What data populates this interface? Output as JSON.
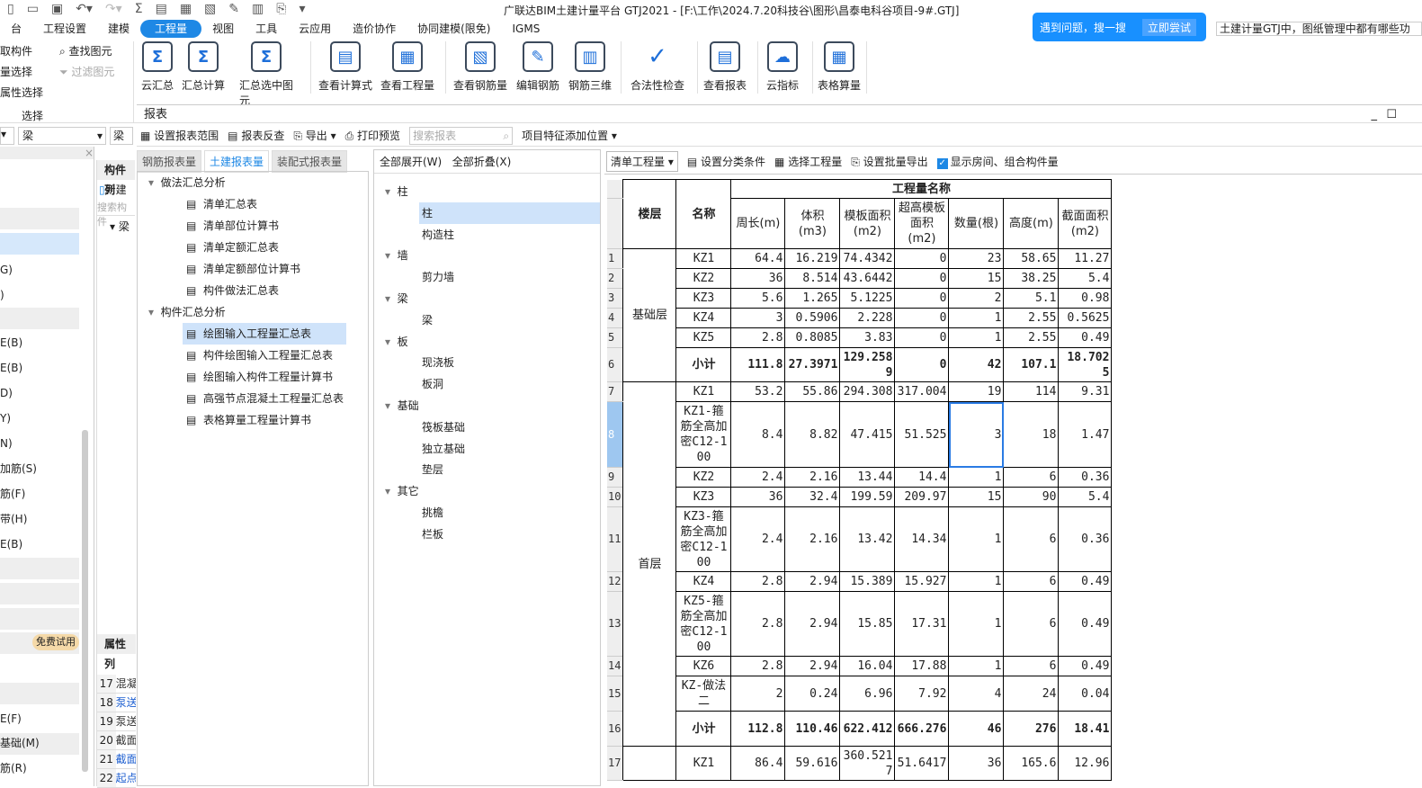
{
  "window": {
    "title": "广联达BIM土建计量平台 GTJ2021 - [F:\\工作\\2024.7.20科技谷\\图形\\昌泰电科谷项目-9#.GTJ]"
  },
  "menu": [
    "台",
    "工程设置",
    "建模",
    "工程量",
    "视图",
    "工具",
    "云应用",
    "造价协作",
    "协同建模(限免)",
    "IGMS"
  ],
  "menu_active": "工程量",
  "help": {
    "text": "遇到问题，搜一搜",
    "button": "立即尝试",
    "query": "土建计量GTJ中，图纸管理中都有哪些功"
  },
  "ribbon": {
    "select_group": {
      "items": [
        "取构件",
        "量选择",
        "属性选择",
        "查找图元",
        "过滤图元"
      ],
      "label": "选择"
    },
    "buttons": [
      "云汇总",
      "汇总计算",
      "汇总选中图元",
      "查看计算式",
      "查看工程量",
      "查看钢筋量",
      "编辑钢筋",
      "钢筋三维",
      "合法性检查",
      "查看报表",
      "云指标",
      "表格算量"
    ]
  },
  "left_panel": {
    "dropdowns": [
      "梁",
      "梁"
    ],
    "items": [
      "G)",
      ")",
      "E(B)",
      "E(B)",
      "D)",
      "Y)",
      "N)",
      "加筋(S)",
      "筋(F)",
      "带(H)",
      "E(B)",
      "E(F)",
      "基础(M)",
      "筋(R)"
    ],
    "trial_badge": "免费试用"
  },
  "component_panel": {
    "header": "构件列",
    "new": "新建",
    "search": "搜索构件",
    "tree": "梁",
    "props_header": "属性列",
    "prop_rows": [
      {
        "n": "17",
        "t": "混凝"
      },
      {
        "n": "18",
        "t": "泵送"
      },
      {
        "n": "19",
        "t": "泵送"
      },
      {
        "n": "20",
        "t": "截面"
      },
      {
        "n": "21",
        "t": "截面"
      },
      {
        "n": "22",
        "t": "起点"
      }
    ]
  },
  "report": {
    "title": "报表",
    "toolbar": {
      "range": "设置报表范围",
      "reverse": "报表反查",
      "export": "导出",
      "print": "打印预览",
      "search_placeholder": "搜索报表",
      "feature": "项目特征添加位置"
    },
    "tabs": [
      "钢筋报表量",
      "土建报表量",
      "装配式报表量"
    ],
    "active_tab": "土建报表量",
    "tree": [
      {
        "label": "做法汇总分析",
        "group": true
      },
      {
        "label": "清单汇总表"
      },
      {
        "label": "清单部位计算书"
      },
      {
        "label": "清单定额汇总表"
      },
      {
        "label": "清单定额部位计算书"
      },
      {
        "label": "构件做法汇总表"
      },
      {
        "label": "构件汇总分析",
        "group": true
      },
      {
        "label": "绘图输入工程量汇总表",
        "selected": true
      },
      {
        "label": "构件绘图输入工程量汇总表"
      },
      {
        "label": "绘图输入构件工程量计算书"
      },
      {
        "label": "高强节点混凝土工程量汇总表"
      },
      {
        "label": "表格算量工程量计算书"
      }
    ],
    "category_toolbar": {
      "expand": "全部展开(W)",
      "collapse": "全部折叠(X)"
    },
    "categories": [
      {
        "label": "柱",
        "group": true
      },
      {
        "label": "柱",
        "selected": true
      },
      {
        "label": "构造柱"
      },
      {
        "label": "墙",
        "group": true
      },
      {
        "label": "剪力墙"
      },
      {
        "label": "梁",
        "group": true
      },
      {
        "label": "梁"
      },
      {
        "label": "板",
        "group": true
      },
      {
        "label": "现浇板"
      },
      {
        "label": "板洞"
      },
      {
        "label": "基础",
        "group": true
      },
      {
        "label": "筏板基础"
      },
      {
        "label": "独立基础"
      },
      {
        "label": "垫层"
      },
      {
        "label": "其它",
        "group": true
      },
      {
        "label": "挑檐"
      },
      {
        "label": "栏板"
      }
    ],
    "grid_toolbar": {
      "type": "清单工程量",
      "classify": "设置分类条件",
      "select": "选择工程量",
      "batch_export": "设置批量导出",
      "show_rooms": "显示房间、组合构件量",
      "show_rooms_checked": true
    },
    "grid": {
      "group_header": "工程量名称",
      "floor_header": "楼层",
      "name_header": "名称",
      "columns": [
        "周长(m)",
        "体积(m3)",
        "模板面积(m2)",
        "超高模板面积(m2)",
        "数量(根)",
        "高度(m)",
        "截面面积(m2)"
      ],
      "rows": [
        {
          "n": "1",
          "floor": "基础层",
          "span": 6,
          "name": "KZ1",
          "v": [
            "64.4",
            "16.219",
            "74.4342",
            "0",
            "23",
            "58.65",
            "11.27"
          ]
        },
        {
          "n": "2",
          "name": "KZ2",
          "v": [
            "36",
            "8.514",
            "43.6442",
            "0",
            "15",
            "38.25",
            "5.4"
          ]
        },
        {
          "n": "3",
          "name": "KZ3",
          "v": [
            "5.6",
            "1.265",
            "5.1225",
            "0",
            "2",
            "5.1",
            "0.98"
          ]
        },
        {
          "n": "4",
          "name": "KZ4",
          "v": [
            "3",
            "0.5906",
            "2.228",
            "0",
            "1",
            "2.55",
            "0.5625"
          ]
        },
        {
          "n": "5",
          "name": "KZ5",
          "v": [
            "2.8",
            "0.8085",
            "3.83",
            "0",
            "1",
            "2.55",
            "0.49"
          ]
        },
        {
          "n": "6",
          "name": "小计",
          "subtotal": true,
          "v": [
            "111.8",
            "27.3971",
            "129.2589",
            "0",
            "42",
            "107.1",
            "18.7025"
          ]
        },
        {
          "n": "7",
          "floor": "首层",
          "span": 10,
          "name": "KZ1",
          "v": [
            "53.2",
            "55.86",
            "294.308",
            "317.004",
            "19",
            "114",
            "9.31"
          ]
        },
        {
          "n": "8",
          "name": "KZ1-箍筋全高加密C12-100",
          "v": [
            "8.4",
            "8.82",
            "47.415",
            "51.525",
            "3",
            "18",
            "1.47"
          ],
          "selected": true
        },
        {
          "n": "9",
          "name": "KZ2",
          "v": [
            "2.4",
            "2.16",
            "13.44",
            "14.4",
            "1",
            "6",
            "0.36"
          ]
        },
        {
          "n": "10",
          "name": "KZ3",
          "v": [
            "36",
            "32.4",
            "199.59",
            "209.97",
            "15",
            "90",
            "5.4"
          ]
        },
        {
          "n": "11",
          "name": "KZ3-箍筋全高加密C12-100",
          "v": [
            "2.4",
            "2.16",
            "13.42",
            "14.34",
            "1",
            "6",
            "0.36"
          ]
        },
        {
          "n": "12",
          "name": "KZ4",
          "v": [
            "2.8",
            "2.94",
            "15.389",
            "15.927",
            "1",
            "6",
            "0.49"
          ]
        },
        {
          "n": "13",
          "name": "KZ5-箍筋全高加密C12-100",
          "v": [
            "2.8",
            "2.94",
            "15.85",
            "17.31",
            "1",
            "6",
            "0.49"
          ]
        },
        {
          "n": "14",
          "name": "KZ6",
          "v": [
            "2.8",
            "2.94",
            "16.04",
            "17.88",
            "1",
            "6",
            "0.49"
          ]
        },
        {
          "n": "15",
          "name": "KZ-做法二",
          "v": [
            "2",
            "0.24",
            "6.96",
            "7.92",
            "4",
            "24",
            "0.04"
          ]
        },
        {
          "n": "16",
          "name": "小计",
          "subtotal": true,
          "v": [
            "112.8",
            "110.46",
            "622.412",
            "666.276",
            "46",
            "276",
            "18.41"
          ]
        },
        {
          "n": "17",
          "floor": "",
          "span": 1,
          "name": "KZ1",
          "v": [
            "86.4",
            "59.616",
            "360.5217",
            "51.6417",
            "36",
            "165.6",
            "12.96"
          ]
        }
      ]
    }
  },
  "colors": {
    "accent": "#1e88e5",
    "selection": "#cfe3fa",
    "help_bg": "#1890ff"
  }
}
